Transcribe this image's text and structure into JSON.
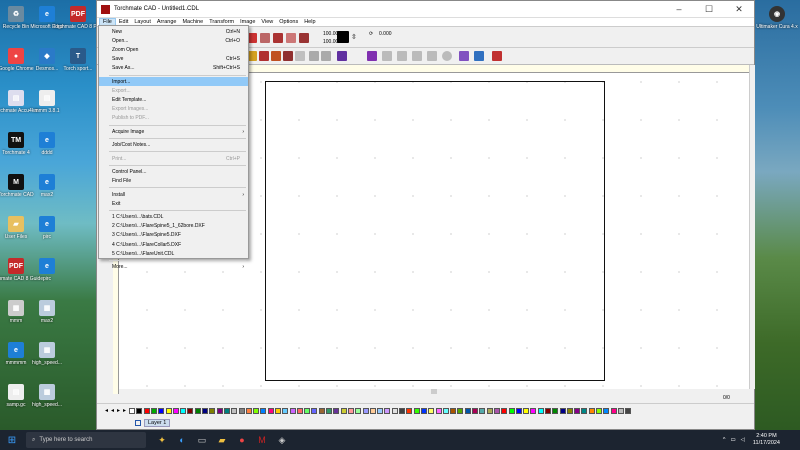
{
  "window": {
    "title": "Torchmate CAD - Untitled1.CDL"
  },
  "menubar": [
    "File",
    "Edit",
    "Layout",
    "Arrange",
    "Machine",
    "Transform",
    "Image",
    "View",
    "Options",
    "Help"
  ],
  "toolbar": {
    "width": "100.000",
    "height": "100.000",
    "rotation": "0.000"
  },
  "file_menu": [
    {
      "label": "New",
      "shortcut": "Ctrl+N",
      "state": "normal"
    },
    {
      "label": "Open...",
      "shortcut": "Ctrl+O",
      "state": "normal"
    },
    {
      "label": "Zoom Open",
      "shortcut": "",
      "state": "normal"
    },
    {
      "label": "Save",
      "shortcut": "Ctrl+S",
      "state": "normal"
    },
    {
      "label": "Save As...",
      "shortcut": "Shift+Ctrl+S",
      "state": "normal"
    },
    {
      "sep": true
    },
    {
      "label": "Import...",
      "shortcut": "",
      "state": "highlight"
    },
    {
      "label": "Export...",
      "shortcut": "",
      "state": "disabled"
    },
    {
      "label": "Edit Template...",
      "shortcut": "",
      "state": "normal"
    },
    {
      "label": "Export Images...",
      "shortcut": "",
      "state": "disabled"
    },
    {
      "label": "Publish to PDF...",
      "shortcut": "",
      "state": "disabled"
    },
    {
      "sep": true
    },
    {
      "label": "Acquire Image",
      "shortcut": "",
      "state": "normal",
      "submenu": true
    },
    {
      "sep": true
    },
    {
      "label": "Job/Cost Notes...",
      "shortcut": "",
      "state": "normal"
    },
    {
      "sep": true
    },
    {
      "label": "Print...",
      "shortcut": "Ctrl+P",
      "state": "disabled"
    },
    {
      "sep": true
    },
    {
      "label": "Control Panel...",
      "shortcut": "",
      "state": "normal"
    },
    {
      "label": "Find File",
      "shortcut": "",
      "state": "normal"
    },
    {
      "sep": true
    },
    {
      "label": "Install",
      "shortcut": "",
      "state": "normal",
      "submenu": true
    },
    {
      "label": "Exit",
      "shortcut": "",
      "state": "normal"
    },
    {
      "sep": true
    },
    {
      "label": "1 C:\\Users\\...\\bats.CDL",
      "shortcut": "",
      "state": "normal"
    },
    {
      "label": "2 C:\\Users\\...\\FlareSpine5_1_62bore.DXF",
      "shortcut": "",
      "state": "normal"
    },
    {
      "label": "3 C:\\Users\\...\\FlareSpine5.DXF",
      "shortcut": "",
      "state": "normal"
    },
    {
      "label": "4 C:\\Users\\...\\FlareCollar5.DXF",
      "shortcut": "",
      "state": "normal"
    },
    {
      "label": "5 C:\\Users\\...\\FlareUnit.CDL",
      "shortcut": "",
      "state": "normal"
    },
    {
      "sep": true
    },
    {
      "label": "More...",
      "shortcut": "",
      "state": "normal",
      "submenu": true
    }
  ],
  "status": {
    "counter": "0/0"
  },
  "layer": {
    "name": "Layer 1"
  },
  "palette": [
    "#ffffff",
    "#000000",
    "#ff0000",
    "#00aa00",
    "#0000ff",
    "#ffff00",
    "#ff00ff",
    "#00ffff",
    "#800000",
    "#008000",
    "#000080",
    "#808000",
    "#800080",
    "#008080",
    "#c0c0c0",
    "#808080",
    "#ff8040",
    "#80ff00",
    "#0080ff",
    "#ff0080",
    "#ffcc00",
    "#66ccff",
    "#cc66ff",
    "#ff6666",
    "#66ff66",
    "#6666ff",
    "#996633",
    "#339966",
    "#663399",
    "#cccc33",
    "#ff9999",
    "#99ff99",
    "#9999ff",
    "#ffcc99",
    "#99ccff",
    "#cc99ff",
    "#e0e0e0",
    "#404040",
    "#ff3300",
    "#33ff00",
    "#0033ff",
    "#ffff66",
    "#ff66ff",
    "#66ffff",
    "#aa5500",
    "#55aa00",
    "#0055aa",
    "#aa0055",
    "#55aaaa",
    "#aaaa55",
    "#aa55aa",
    "#ff0000",
    "#00ff00",
    "#0000ff",
    "#ffff00",
    "#ff00ff",
    "#00ffff",
    "#880000",
    "#008800",
    "#000088",
    "#888800",
    "#880088",
    "#008888",
    "#ff8800",
    "#88ff00",
    "#0088ff",
    "#ff0088",
    "#bbbbbb",
    "#444444"
  ],
  "desktop_left": [
    {
      "label": "Recycle Bin",
      "color": "#6a8aa0",
      "glyph": "♻"
    },
    {
      "label": "Microsoft Edge",
      "color": "#1e7fd6",
      "glyph": "e"
    },
    {
      "label": "Torchmate CAD 8 PDF",
      "color": "#c42a2a",
      "glyph": "PDF"
    },
    {
      "label": "Google Chrome",
      "color": "#e44",
      "glyph": "●"
    },
    {
      "label": "Desmos...",
      "color": "#2a7ac8",
      "glyph": "◆"
    },
    {
      "label": "Torch sport...",
      "color": "#2a5a8a",
      "glyph": "T"
    },
    {
      "label": "Torchmate Accu4km",
      "color": "#dde",
      "glyph": "▤"
    },
    {
      "label": "mmm 3.8.1",
      "color": "#eee",
      "glyph": "▤"
    },
    {
      "label": "Torchmate 4",
      "color": "#111",
      "glyph": "TM"
    },
    {
      "label": "dddd",
      "color": "#1e7fd6",
      "glyph": "e"
    },
    {
      "label": "Torchmate CAD",
      "color": "#111",
      "glyph": "M"
    },
    {
      "label": "max2",
      "color": "#1e7fd6",
      "glyph": "e"
    },
    {
      "label": "User Files",
      "color": "#e8c060",
      "glyph": "▰"
    },
    {
      "label": "pirc",
      "color": "#1e7fd6",
      "glyph": "e"
    },
    {
      "label": "Torchmate CAD 8 Guide",
      "color": "#c42a2a",
      "glyph": "PDF"
    },
    {
      "label": "pirc",
      "color": "#1e7fd6",
      "glyph": "e"
    },
    {
      "label": "mmm",
      "color": "#ccc",
      "glyph": "▦"
    },
    {
      "label": "max2",
      "color": "#bcd",
      "glyph": "▦"
    },
    {
      "label": "mmmmm",
      "color": "#1e7fd6",
      "glyph": "e"
    },
    {
      "label": "high_speed...",
      "color": "#bcd",
      "glyph": "▦"
    },
    {
      "label": "samp.gc",
      "color": "#eee",
      "glyph": "▤"
    },
    {
      "label": "high_speed...",
      "color": "#bcd",
      "glyph": "▦"
    }
  ],
  "desktop_right": {
    "label": "Ultimaker Cura 4.x",
    "color": "#333",
    "glyph": "◉"
  },
  "taskbar": {
    "search_placeholder": "Type here to search",
    "time": "2:40 PM",
    "date": "11/17/2024"
  }
}
